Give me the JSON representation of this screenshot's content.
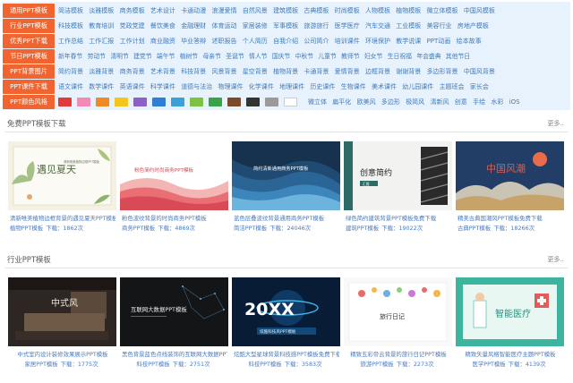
{
  "nav": {
    "rows": [
      {
        "label": "通用PPT模板",
        "links": [
          "简洁模板",
          "淡雅模板",
          "商务模板",
          "艺术设计",
          "卡通动漫",
          "浪漫爱情",
          "自然风景",
          "建筑模板",
          "古典模板",
          "时尚模板",
          "人物模板",
          "植物模板",
          "微立体模板",
          "中国风模板"
        ]
      },
      {
        "label": "行业PPT模板",
        "links": [
          "科技模板",
          "教育培训",
          "党政党建",
          "餐饮美食",
          "金融理财",
          "体育运动",
          "家居装修",
          "军事模板",
          "旅游旅行",
          "医学医疗",
          "汽车交通",
          "工业模板",
          "美容行业",
          "房地产模板"
        ]
      },
      {
        "label": "优秀PPT下载",
        "links": [
          "工作总结",
          "工作汇报",
          "工作计划",
          "商业融资",
          "毕业答辩",
          "述职报告",
          "个人简历",
          "自我介绍",
          "公司简介",
          "培训课件",
          "环境保护",
          "教学说课",
          "PPT动画",
          "绘本故事"
        ]
      },
      {
        "label": "节日PPT模板",
        "links": [
          "新年春节",
          "劳动节",
          "清明节",
          "建党节",
          "端午节",
          "植树节",
          "母亲节",
          "圣诞节",
          "情人节",
          "国庆节",
          "中秋节",
          "儿童节",
          "教师节",
          "妇女节",
          "生日祝福",
          "年会盛典",
          "其他节日"
        ]
      },
      {
        "label": "PPT背景图片",
        "links": [
          "简约背景",
          "淡雅背景",
          "商务背景",
          "艺术背景",
          "科技背景",
          "风景背景",
          "星空背景",
          "植物背景",
          "卡通背景",
          "爱情背景",
          "边框背景",
          "谢谢背景",
          "多边形背景",
          "中国风背景"
        ]
      },
      {
        "label": "PPT课件下载",
        "links": [
          "语文课件",
          "数学课件",
          "英语课件",
          "科学课件",
          "道德与法治",
          "物理课件",
          "化学课件",
          "地理课件",
          "历史课件",
          "生物课件",
          "美术课件",
          "幼儿园课件",
          "主题班会",
          "家长会"
        ]
      },
      {
        "label": "PPT颜色风格",
        "links": []
      }
    ],
    "colors": [
      "#e03a3a",
      "#f28ab6",
      "#ef8a25",
      "#f6c51c",
      "#8d5fc8",
      "#2e7fd5",
      "#3aa1d9",
      "#7dc243",
      "#39a34a",
      "#7a4b2a",
      "#333333",
      "#9a9a9a",
      "#ffffff"
    ],
    "style_links": [
      "微立体",
      "扁平化",
      "欧美风",
      "多边形",
      "极简风",
      "清新风",
      "创意",
      "手绘",
      "水彩",
      "iOS"
    ]
  },
  "sections": [
    {
      "title": "免费PPT模板下载",
      "more": "更多..",
      "cards": [
        {
          "line1": "清新唯美植物边框背景的遇见夏天PPT模板",
          "line2": "植物PPT模板",
          "downloads": "下载：1862次",
          "thumb_text": "遇见夏天",
          "thumb_sub": "清新唯美植物边框PPT模板"
        },
        {
          "line1": "粉色波纹背景的时尚商务PPT模板",
          "line2": "商务PPT模板",
          "downloads": "下载：4869次",
          "thumb_text": "粉色简约时尚商务PPT模板",
          "thumb_sub": ""
        },
        {
          "line1": "蓝色层叠波纹背景通用商务PPT模板",
          "line2": "简洁PPT模板",
          "downloads": "下载：24046次",
          "thumb_text": "简约清新通用商务PPT模板",
          "thumb_sub": ""
        },
        {
          "line1": "绿色简约建筑背景PPT模板免费下载",
          "line2": "建筑PPT模板",
          "downloads": "下载：19022次",
          "thumb_text": "创意简约",
          "thumb_sub": "汇报"
        },
        {
          "line1": "精美古典国潮风PPT模板免费下载",
          "line2": "古典PPT模板",
          "downloads": "下载：18266次",
          "thumb_text": "中国风潮",
          "thumb_sub": ""
        }
      ]
    },
    {
      "title": "行业PPT模板",
      "more": "更多..",
      "cards": [
        {
          "line1": "中式室内设计装修效果展示PPT模板",
          "line2": "家居PPT模板",
          "downloads": "下载：1775次",
          "thumb_text": "中式风",
          "thumb_sub": ""
        },
        {
          "line1": "黑色背景蓝色点线装饰的互联网大数据PPT模板",
          "line2": "科技PPT模板",
          "downloads": "下载：2751次",
          "thumb_text": "互联网大数据PPT模板",
          "thumb_sub": ""
        },
        {
          "line1": "炫酷大型星球背景科技感PPT模板免费下载",
          "line2": "科技PPT模板",
          "downloads": "下载：3583次",
          "thumb_text": "20XX",
          "thumb_sub": "炫酷科技风PPT模板"
        },
        {
          "line1": "精致五彩帝云背景的旅行日记PPT模板",
          "line2": "旅游PPT模板",
          "downloads": "下载：2273次",
          "thumb_text": "旅行日记",
          "thumb_sub": ""
        },
        {
          "line1": "精致矢量风格智能医疗主题PPT模板",
          "line2": "医学PPT模板",
          "downloads": "下载：4139次",
          "thumb_text": "智能医疗",
          "thumb_sub": ""
        }
      ]
    }
  ]
}
